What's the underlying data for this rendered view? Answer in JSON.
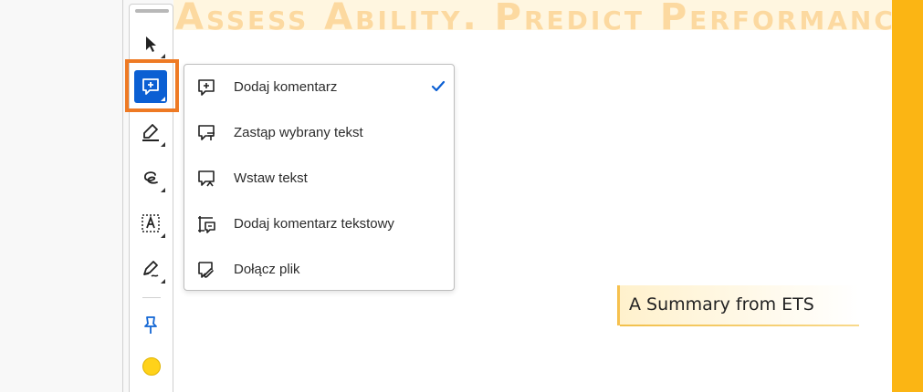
{
  "document": {
    "banner_text": "Assess Ability. Predict Performance.",
    "summary_label": "A Summary from ETS",
    "accent_color": "#fbb514"
  },
  "toolbar": {
    "tools": [
      {
        "name": "select-tool",
        "icon": "arrow-cursor-icon"
      },
      {
        "name": "add-comment-tool",
        "icon": "comment-plus-icon",
        "active": true
      },
      {
        "name": "highlight-tool",
        "icon": "highlighter-icon"
      },
      {
        "name": "draw-tool",
        "icon": "freehand-loop-icon"
      },
      {
        "name": "text-box-tool",
        "icon": "text-box-icon"
      },
      {
        "name": "sign-tool",
        "icon": "pen-sign-icon"
      },
      {
        "name": "pin-tool",
        "icon": "pin-icon"
      }
    ],
    "current_color": "#ffd21a",
    "highlight_color": "#ee7a24"
  },
  "comment_menu": {
    "items": [
      {
        "label": "Dodaj komentarz",
        "icon": "comment-plus-icon",
        "checked": true
      },
      {
        "label": "Zastąp wybrany tekst",
        "icon": "replace-text-icon",
        "checked": false
      },
      {
        "label": "Wstaw tekst",
        "icon": "insert-text-icon",
        "checked": false
      },
      {
        "label": "Dodaj komentarz tekstowy",
        "icon": "text-comment-icon",
        "checked": false
      },
      {
        "label": "Dołącz plik",
        "icon": "attach-file-icon",
        "checked": false
      }
    ],
    "check_color": "#0b5fd3"
  }
}
